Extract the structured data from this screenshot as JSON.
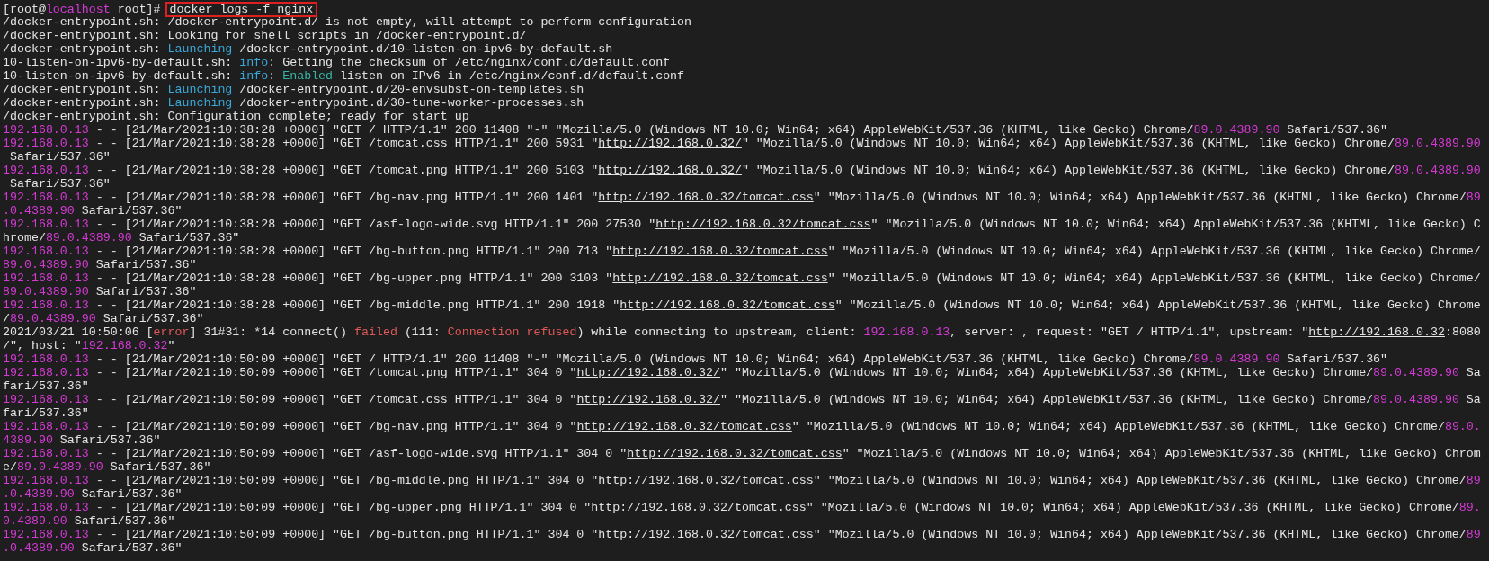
{
  "terminal": {
    "rows": [
      {
        "prompt": [
          {
            "kind": "plain",
            "text": "[root@"
          },
          {
            "kind": "host",
            "text": "localhost"
          },
          {
            "kind": "plain",
            "text": " root]# "
          }
        ],
        "command": "docker logs -f nginx"
      },
      {
        "segments": [
          {
            "kind": "plain",
            "text": "/docker-entrypoint.sh: /docker-entrypoint.d/ is not empty, will attempt to perform configuration"
          }
        ]
      },
      {
        "segments": [
          {
            "kind": "plain",
            "text": "/docker-entrypoint.sh: Looking for shell scripts in /docker-entrypoint.d/"
          }
        ]
      },
      {
        "segments": [
          {
            "kind": "plain",
            "text": "/docker-entrypoint.sh: "
          },
          {
            "kind": "keyword",
            "text": "Launching"
          },
          {
            "kind": "plain",
            "text": " /docker-entrypoint.d/10-listen-on-ipv6-by-default.sh"
          }
        ]
      },
      {
        "segments": [
          {
            "kind": "plain",
            "text": "10-listen-on-ipv6-by-default.sh: "
          },
          {
            "kind": "keyword",
            "text": "info"
          },
          {
            "kind": "plain",
            "text": ": Getting the checksum of /etc/nginx/conf.d/default.conf"
          }
        ]
      },
      {
        "segments": [
          {
            "kind": "plain",
            "text": "10-listen-on-ipv6-by-default.sh: "
          },
          {
            "kind": "keyword",
            "text": "info"
          },
          {
            "kind": "plain",
            "text": ": "
          },
          {
            "kind": "success",
            "text": "Enabled"
          },
          {
            "kind": "plain",
            "text": " listen on IPv6 in /etc/nginx/conf.d/default.conf"
          }
        ]
      },
      {
        "segments": [
          {
            "kind": "plain",
            "text": "/docker-entrypoint.sh: "
          },
          {
            "kind": "keyword",
            "text": "Launching"
          },
          {
            "kind": "plain",
            "text": " /docker-entrypoint.d/20-envsubst-on-templates.sh"
          }
        ]
      },
      {
        "segments": [
          {
            "kind": "plain",
            "text": "/docker-entrypoint.sh: "
          },
          {
            "kind": "keyword",
            "text": "Launching"
          },
          {
            "kind": "plain",
            "text": " /docker-entrypoint.d/30-tune-worker-processes.sh"
          }
        ]
      },
      {
        "segments": [
          {
            "kind": "plain",
            "text": "/docker-entrypoint.sh: Configuration complete; ready for start up"
          }
        ]
      },
      {
        "segments": [
          {
            "kind": "ip",
            "text": "192.168.0.13"
          },
          {
            "kind": "plain",
            "text": " - - [21/Mar/2021:10:38:28 +0000] \"GET / HTTP/1.1\" 200 11408 \"-\" \"Mozilla/5.0 (Windows NT 10.0; Win64; x64) AppleWebKit/537.36 (KHTML, like Gecko) Chrome/"
          },
          {
            "kind": "version",
            "text": "89.0.4389.90"
          },
          {
            "kind": "plain",
            "text": " Safari/537.36\""
          }
        ]
      },
      {
        "segments": [
          {
            "kind": "ip",
            "text": "192.168.0.13"
          },
          {
            "kind": "plain",
            "text": " - - [21/Mar/2021:10:38:28 +0000] \"GET /tomcat.css HTTP/1.1\" 200 5931 \""
          },
          {
            "kind": "url",
            "text": "http://192.168.0.32/"
          },
          {
            "kind": "plain",
            "text": "\" \"Mozilla/5.0 (Windows NT 10.0; Win64; x64) AppleWebKit/537.36 (KHTML, like Gecko) Chrome/"
          },
          {
            "kind": "version",
            "text": "89.0.4389.90"
          }
        ]
      },
      {
        "segments": [
          {
            "kind": "plain",
            "text": " Safari/537.36\""
          }
        ]
      },
      {
        "segments": [
          {
            "kind": "ip",
            "text": "192.168.0.13"
          },
          {
            "kind": "plain",
            "text": " - - [21/Mar/2021:10:38:28 +0000] \"GET /tomcat.png HTTP/1.1\" 200 5103 \""
          },
          {
            "kind": "url",
            "text": "http://192.168.0.32/"
          },
          {
            "kind": "plain",
            "text": "\" \"Mozilla/5.0 (Windows NT 10.0; Win64; x64) AppleWebKit/537.36 (KHTML, like Gecko) Chrome/"
          },
          {
            "kind": "version",
            "text": "89.0.4389.90"
          }
        ]
      },
      {
        "segments": [
          {
            "kind": "plain",
            "text": " Safari/537.36\""
          }
        ]
      },
      {
        "segments": [
          {
            "kind": "ip",
            "text": "192.168.0.13"
          },
          {
            "kind": "plain",
            "text": " - - [21/Mar/2021:10:38:28 +0000] \"GET /bg-nav.png HTTP/1.1\" 200 1401 \""
          },
          {
            "kind": "url",
            "text": "http://192.168.0.32/tomcat.css"
          },
          {
            "kind": "plain",
            "text": "\" \"Mozilla/5.0 (Windows NT 10.0; Win64; x64) AppleWebKit/537.36 (KHTML, like Gecko) Chrome/"
          },
          {
            "kind": "version",
            "text": "89"
          }
        ]
      },
      {
        "segments": [
          {
            "kind": "version",
            "text": ".0.4389.90"
          },
          {
            "kind": "plain",
            "text": " Safari/537.36\""
          }
        ]
      },
      {
        "segments": [
          {
            "kind": "ip",
            "text": "192.168.0.13"
          },
          {
            "kind": "plain",
            "text": " - - [21/Mar/2021:10:38:28 +0000] \"GET /asf-logo-wide.svg HTTP/1.1\" 200 27530 \""
          },
          {
            "kind": "url",
            "text": "http://192.168.0.32/tomcat.css"
          },
          {
            "kind": "plain",
            "text": "\" \"Mozilla/5.0 (Windows NT 10.0; Win64; x64) AppleWebKit/537.36 (KHTML, like Gecko) C"
          }
        ]
      },
      {
        "segments": [
          {
            "kind": "plain",
            "text": "hrome/"
          },
          {
            "kind": "version",
            "text": "89.0.4389.90"
          },
          {
            "kind": "plain",
            "text": " Safari/537.36\""
          }
        ]
      },
      {
        "segments": [
          {
            "kind": "ip",
            "text": "192.168.0.13"
          },
          {
            "kind": "plain",
            "text": " - - [21/Mar/2021:10:38:28 +0000] \"GET /bg-button.png HTTP/1.1\" 200 713 \""
          },
          {
            "kind": "url",
            "text": "http://192.168.0.32/tomcat.css"
          },
          {
            "kind": "plain",
            "text": "\" \"Mozilla/5.0 (Windows NT 10.0; Win64; x64) AppleWebKit/537.36 (KHTML, like Gecko) Chrome/"
          }
        ]
      },
      {
        "segments": [
          {
            "kind": "version",
            "text": "89.0.4389.90"
          },
          {
            "kind": "plain",
            "text": " Safari/537.36\""
          }
        ]
      },
      {
        "segments": [
          {
            "kind": "ip",
            "text": "192.168.0.13"
          },
          {
            "kind": "plain",
            "text": " - - [21/Mar/2021:10:38:28 +0000] \"GET /bg-upper.png HTTP/1.1\" 200 3103 \""
          },
          {
            "kind": "url",
            "text": "http://192.168.0.32/tomcat.css"
          },
          {
            "kind": "plain",
            "text": "\" \"Mozilla/5.0 (Windows NT 10.0; Win64; x64) AppleWebKit/537.36 (KHTML, like Gecko) Chrome/"
          }
        ]
      },
      {
        "segments": [
          {
            "kind": "version",
            "text": "89.0.4389.90"
          },
          {
            "kind": "plain",
            "text": " Safari/537.36\""
          }
        ]
      },
      {
        "segments": [
          {
            "kind": "ip",
            "text": "192.168.0.13"
          },
          {
            "kind": "plain",
            "text": " - - [21/Mar/2021:10:38:28 +0000] \"GET /bg-middle.png HTTP/1.1\" 200 1918 \""
          },
          {
            "kind": "url",
            "text": "http://192.168.0.32/tomcat.css"
          },
          {
            "kind": "plain",
            "text": "\" \"Mozilla/5.0 (Windows NT 10.0; Win64; x64) AppleWebKit/537.36 (KHTML, like Gecko) Chrome"
          }
        ]
      },
      {
        "segments": [
          {
            "kind": "plain",
            "text": "/"
          },
          {
            "kind": "version",
            "text": "89.0.4389.90"
          },
          {
            "kind": "plain",
            "text": " Safari/537.36\""
          }
        ]
      },
      {
        "segments": [
          {
            "kind": "plain",
            "text": "2021/03/21 10:50:06 ["
          },
          {
            "kind": "error",
            "text": "error"
          },
          {
            "kind": "plain",
            "text": "] 31#31: *14 connect() "
          },
          {
            "kind": "error",
            "text": "failed"
          },
          {
            "kind": "plain",
            "text": " (111: "
          },
          {
            "kind": "error",
            "text": "Connection refused"
          },
          {
            "kind": "plain",
            "text": ") while connecting to upstream, client: "
          },
          {
            "kind": "ip",
            "text": "192.168.0.13"
          },
          {
            "kind": "plain",
            "text": ", server: , request: \"GET / HTTP/1.1\", upstream: \""
          },
          {
            "kind": "url",
            "text": "http://192.168.0.32"
          },
          {
            "kind": "plain",
            "text": ":8080"
          }
        ]
      },
      {
        "segments": [
          {
            "kind": "plain",
            "text": "/\", host: \""
          },
          {
            "kind": "ip",
            "text": "192.168.0.32"
          },
          {
            "kind": "plain",
            "text": "\""
          }
        ]
      },
      {
        "segments": [
          {
            "kind": "ip",
            "text": "192.168.0.13"
          },
          {
            "kind": "plain",
            "text": " - - [21/Mar/2021:10:50:09 +0000] \"GET / HTTP/1.1\" 200 11408 \"-\" \"Mozilla/5.0 (Windows NT 10.0; Win64; x64) AppleWebKit/537.36 (KHTML, like Gecko) Chrome/"
          },
          {
            "kind": "version",
            "text": "89.0.4389.90"
          },
          {
            "kind": "plain",
            "text": " Safari/537.36\""
          }
        ]
      },
      {
        "segments": [
          {
            "kind": "ip",
            "text": "192.168.0.13"
          },
          {
            "kind": "plain",
            "text": " - - [21/Mar/2021:10:50:09 +0000] \"GET /tomcat.png HTTP/1.1\" 304 0 \""
          },
          {
            "kind": "url",
            "text": "http://192.168.0.32/"
          },
          {
            "kind": "plain",
            "text": "\" \"Mozilla/5.0 (Windows NT 10.0; Win64; x64) AppleWebKit/537.36 (KHTML, like Gecko) Chrome/"
          },
          {
            "kind": "version",
            "text": "89.0.4389.90"
          },
          {
            "kind": "plain",
            "text": " Sa"
          }
        ]
      },
      {
        "segments": [
          {
            "kind": "plain",
            "text": "fari/537.36\""
          }
        ]
      },
      {
        "segments": [
          {
            "kind": "ip",
            "text": "192.168.0.13"
          },
          {
            "kind": "plain",
            "text": " - - [21/Mar/2021:10:50:09 +0000] \"GET /tomcat.css HTTP/1.1\" 304 0 \""
          },
          {
            "kind": "url",
            "text": "http://192.168.0.32/"
          },
          {
            "kind": "plain",
            "text": "\" \"Mozilla/5.0 (Windows NT 10.0; Win64; x64) AppleWebKit/537.36 (KHTML, like Gecko) Chrome/"
          },
          {
            "kind": "version",
            "text": "89.0.4389.90"
          },
          {
            "kind": "plain",
            "text": " Sa"
          }
        ]
      },
      {
        "segments": [
          {
            "kind": "plain",
            "text": "fari/537.36\""
          }
        ]
      },
      {
        "segments": [
          {
            "kind": "ip",
            "text": "192.168.0.13"
          },
          {
            "kind": "plain",
            "text": " - - [21/Mar/2021:10:50:09 +0000] \"GET /bg-nav.png HTTP/1.1\" 304 0 \""
          },
          {
            "kind": "url",
            "text": "http://192.168.0.32/tomcat.css"
          },
          {
            "kind": "plain",
            "text": "\" \"Mozilla/5.0 (Windows NT 10.0; Win64; x64) AppleWebKit/537.36 (KHTML, like Gecko) Chrome/"
          },
          {
            "kind": "version",
            "text": "89.0."
          }
        ]
      },
      {
        "segments": [
          {
            "kind": "version",
            "text": "4389.90"
          },
          {
            "kind": "plain",
            "text": " Safari/537.36\""
          }
        ]
      },
      {
        "segments": [
          {
            "kind": "ip",
            "text": "192.168.0.13"
          },
          {
            "kind": "plain",
            "text": " - - [21/Mar/2021:10:50:09 +0000] \"GET /asf-logo-wide.svg HTTP/1.1\" 304 0 \""
          },
          {
            "kind": "url",
            "text": "http://192.168.0.32/tomcat.css"
          },
          {
            "kind": "plain",
            "text": "\" \"Mozilla/5.0 (Windows NT 10.0; Win64; x64) AppleWebKit/537.36 (KHTML, like Gecko) Chrom"
          }
        ]
      },
      {
        "segments": [
          {
            "kind": "plain",
            "text": "e/"
          },
          {
            "kind": "version",
            "text": "89.0.4389.90"
          },
          {
            "kind": "plain",
            "text": " Safari/537.36\""
          }
        ]
      },
      {
        "segments": [
          {
            "kind": "ip",
            "text": "192.168.0.13"
          },
          {
            "kind": "plain",
            "text": " - - [21/Mar/2021:10:50:09 +0000] \"GET /bg-middle.png HTTP/1.1\" 304 0 \""
          },
          {
            "kind": "url",
            "text": "http://192.168.0.32/tomcat.css"
          },
          {
            "kind": "plain",
            "text": "\" \"Mozilla/5.0 (Windows NT 10.0; Win64; x64) AppleWebKit/537.36 (KHTML, like Gecko) Chrome/"
          },
          {
            "kind": "version",
            "text": "89"
          }
        ]
      },
      {
        "segments": [
          {
            "kind": "version",
            "text": ".0.4389.90"
          },
          {
            "kind": "plain",
            "text": " Safari/537.36\""
          }
        ]
      },
      {
        "segments": [
          {
            "kind": "ip",
            "text": "192.168.0.13"
          },
          {
            "kind": "plain",
            "text": " - - [21/Mar/2021:10:50:09 +0000] \"GET /bg-upper.png HTTP/1.1\" 304 0 \""
          },
          {
            "kind": "url",
            "text": "http://192.168.0.32/tomcat.css"
          },
          {
            "kind": "plain",
            "text": "\" \"Mozilla/5.0 (Windows NT 10.0; Win64; x64) AppleWebKit/537.36 (KHTML, like Gecko) Chrome/"
          },
          {
            "kind": "version",
            "text": "89."
          }
        ]
      },
      {
        "segments": [
          {
            "kind": "version",
            "text": "0.4389.90"
          },
          {
            "kind": "plain",
            "text": " Safari/537.36\""
          }
        ]
      },
      {
        "segments": [
          {
            "kind": "ip",
            "text": "192.168.0.13"
          },
          {
            "kind": "plain",
            "text": " - - [21/Mar/2021:10:50:09 +0000] \"GET /bg-button.png HTTP/1.1\" 304 0 \""
          },
          {
            "kind": "url",
            "text": "http://192.168.0.32/tomcat.css"
          },
          {
            "kind": "plain",
            "text": "\" \"Mozilla/5.0 (Windows NT 10.0; Win64; x64) AppleWebKit/537.36 (KHTML, like Gecko) Chrome/"
          },
          {
            "kind": "version",
            "text": "89"
          }
        ]
      },
      {
        "segments": [
          {
            "kind": "version",
            "text": ".0.4389.90"
          },
          {
            "kind": "plain",
            "text": " Safari/537.36\""
          }
        ]
      }
    ]
  }
}
